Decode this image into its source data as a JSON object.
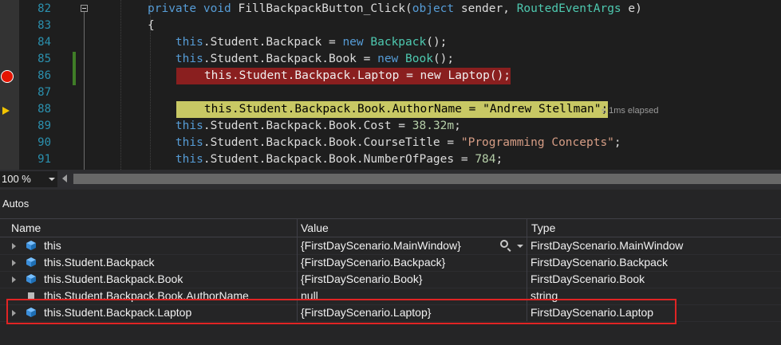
{
  "editor": {
    "lines": [
      {
        "num": "82",
        "tokens": [
          {
            "t": "private ",
            "c": "kw"
          },
          {
            "t": "void ",
            "c": "kw"
          },
          {
            "t": "FillBackpackButton_Click(",
            "c": "pl"
          },
          {
            "t": "object ",
            "c": "kw"
          },
          {
            "t": "sender, ",
            "c": "pl"
          },
          {
            "t": "RoutedEventArgs ",
            "c": "ty"
          },
          {
            "t": "e)",
            "c": "pl"
          }
        ]
      },
      {
        "num": "83",
        "tokens": [
          {
            "t": "{",
            "c": "pl"
          }
        ]
      },
      {
        "num": "84",
        "tokens": [
          {
            "t": "    this",
            "c": "kw"
          },
          {
            "t": ".Student.Backpack = ",
            "c": "pl"
          },
          {
            "t": "new ",
            "c": "kw"
          },
          {
            "t": "Backpack",
            "c": "ty"
          },
          {
            "t": "();",
            "c": "pl"
          }
        ]
      },
      {
        "num": "85",
        "tokens": [
          {
            "t": "    this",
            "c": "kw"
          },
          {
            "t": ".Student.Backpack.Book = ",
            "c": "pl"
          },
          {
            "t": "new ",
            "c": "kw"
          },
          {
            "t": "Book",
            "c": "ty"
          },
          {
            "t": "();",
            "c": "pl"
          }
        ]
      },
      {
        "num": "86",
        "tokens": [
          {
            "t": "    this.Student.Backpack.Laptop = new Laptop();",
            "c": "pl"
          }
        ]
      },
      {
        "num": "87",
        "tokens": []
      },
      {
        "num": "88",
        "tokens": [
          {
            "t": "    this.Student.Backpack.Book.AuthorName = \"Andrew Stellman\";",
            "c": "pl"
          }
        ]
      },
      {
        "num": "89",
        "tokens": [
          {
            "t": "    this",
            "c": "kw"
          },
          {
            "t": ".Student.Backpack.Book.Cost = ",
            "c": "pl"
          },
          {
            "t": "38.32m",
            "c": "num"
          },
          {
            "t": ";",
            "c": "pl"
          }
        ]
      },
      {
        "num": "90",
        "tokens": [
          {
            "t": "    this",
            "c": "kw"
          },
          {
            "t": ".Student.Backpack.Book.CourseTitle = ",
            "c": "pl"
          },
          {
            "t": "\"Programming Concepts\"",
            "c": "str"
          },
          {
            "t": ";",
            "c": "pl"
          }
        ]
      },
      {
        "num": "91",
        "tokens": [
          {
            "t": "    this",
            "c": "kw"
          },
          {
            "t": ".Student.Backpack.Book.NumberOfPages = ",
            "c": "pl"
          },
          {
            "t": "784",
            "c": "num"
          },
          {
            "t": ";",
            "c": "pl"
          }
        ]
      }
    ],
    "elapsed": "≤ 1ms elapsed"
  },
  "zoom": {
    "value": "100 %"
  },
  "autos": {
    "title": "Autos",
    "columns": {
      "name": "Name",
      "value": "Value",
      "type": "Type"
    },
    "rows": [
      {
        "name": "this",
        "value": "{FirstDayScenario.MainWindow}",
        "type": "FirstDayScenario.MainWindow"
      },
      {
        "name": "this.Student.Backpack",
        "value": "{FirstDayScenario.Backpack}",
        "type": "FirstDayScenario.Backpack"
      },
      {
        "name": "this.Student.Backpack.Book",
        "value": "{FirstDayScenario.Book}",
        "type": "FirstDayScenario.Book"
      },
      {
        "name": "this.Student.Backpack.Book.AuthorName",
        "value": "null",
        "type": "string"
      },
      {
        "name": "this.Student.Backpack.Laptop",
        "value": "{FirstDayScenario.Laptop}",
        "type": "FirstDayScenario.Laptop"
      }
    ]
  },
  "colors": {
    "breakpoint": "#e51400",
    "current_line": "#c8c864",
    "annotation_box": "#e02424"
  }
}
